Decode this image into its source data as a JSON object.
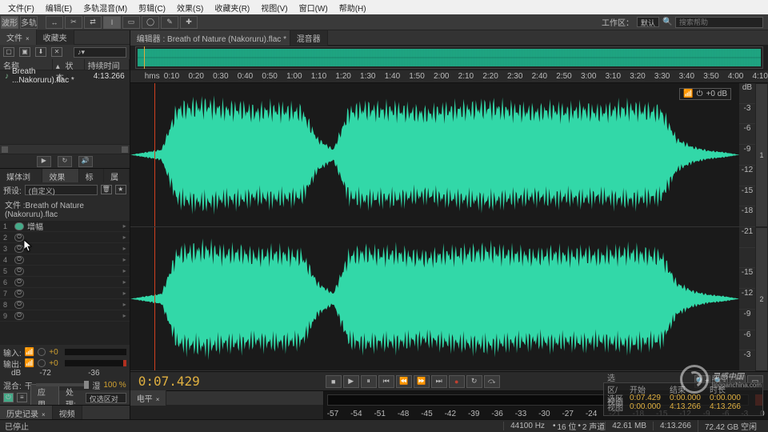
{
  "menu": {
    "file": "文件(F)",
    "edit": "编辑(E)",
    "multitrack": "多轨混音(M)",
    "clip": "剪辑(C)",
    "effects": "效果(S)",
    "favorites": "收藏夹(R)",
    "view": "视图(V)",
    "window": "窗口(W)",
    "help": "帮助(H)"
  },
  "toolbar": {
    "waveform": "波形",
    "multitrack": "多轨",
    "workspace_label": "工作区：",
    "workspace_value": "默认",
    "search_placeholder": "搜索帮助"
  },
  "files_panel": {
    "tab_file": "文件",
    "tab_fav": "收藏夹",
    "col_name": "名称",
    "col_status": "状态",
    "col_duration": "持续时间",
    "row1_name": "Breath ...Nakoruru).flac *",
    "row1_dur": "4:13.266"
  },
  "fx_panel": {
    "tab_browser": "媒体浏览器",
    "tab_fx": "效果组",
    "tab_marker": "标记",
    "tab_props": "属性",
    "preset_label": "预设:",
    "preset_value": "(自定义)",
    "file_label": "文件 :Breath of Nature (Nakoruru).flac",
    "row1_label": "增幅",
    "rows": [
      "1",
      "2",
      "3",
      "4",
      "5",
      "6",
      "7",
      "8",
      "9"
    ]
  },
  "io": {
    "in_label": "输入:",
    "out_label": "输出:",
    "val": "+0",
    "scale": [
      "dB",
      "-72",
      "",
      "-36",
      ""
    ],
    "mix_label": "混合:",
    "mix_mode": "干",
    "mix_wet": "湿",
    "mix_pct": "100 %",
    "apply": "应用",
    "process_label": "处理:",
    "process_value": "仅选区对象"
  },
  "history": {
    "tab_history": "历史记录",
    "tab_video": "视频"
  },
  "editor": {
    "tab_label": "编辑器 : Breath of Nature (Nakoruru).flac *",
    "tab_mixer": "混音器",
    "ruler_prefix": "hms",
    "ticks": [
      "0:10",
      "0:20",
      "0:30",
      "0:40",
      "0:50",
      "1:00",
      "1:10",
      "1:20",
      "1:30",
      "1:40",
      "1:50",
      "2:00",
      "2:10",
      "2:20",
      "2:30",
      "2:40",
      "2:50",
      "3:00",
      "3:10",
      "3:20",
      "3:30",
      "3:40",
      "3:50",
      "4:00",
      "4:10"
    ],
    "db_marks": [
      "dB",
      "-3",
      "-6",
      "-9",
      "-12",
      "-15",
      "-18",
      "-21",
      "",
      "-15",
      "-12",
      "-9",
      "-6",
      "-3"
    ],
    "ch1": "1",
    "ch2": "2",
    "hud_db": "+0 dB"
  },
  "transport": {
    "timecode": "0:07.429"
  },
  "levels": {
    "tab": "电平",
    "scale": [
      "-57",
      "-54",
      "-51",
      "-48",
      "-45",
      "-42",
      "-39",
      "-36",
      "-33",
      "-30",
      "-27",
      "-24",
      "-21",
      "-18",
      "-15",
      "-12",
      "-9",
      "-6",
      "-3",
      "0"
    ]
  },
  "selection": {
    "hdr1": "选区/视图",
    "hdr2": "开始",
    "hdr3": "结束",
    "hdr4": "时长",
    "r1": "选区",
    "r1a": "0:07.429",
    "r1b": "0:00.000",
    "r1c": "0:00.000",
    "r2": "视图",
    "r2a": "0:00.000",
    "r2b": "4:13.266",
    "r2c": "4:13.266"
  },
  "status": {
    "state": "已停止",
    "sr": "44100 Hz",
    "bit": "16 位",
    "ch": "2 声道",
    "size": "42.61 MB",
    "dur": "4:13.266",
    "disk": "72.42 GB 空闲"
  },
  "watermark": {
    "text": "灵感中国",
    "sub": "lingganchina.com"
  }
}
